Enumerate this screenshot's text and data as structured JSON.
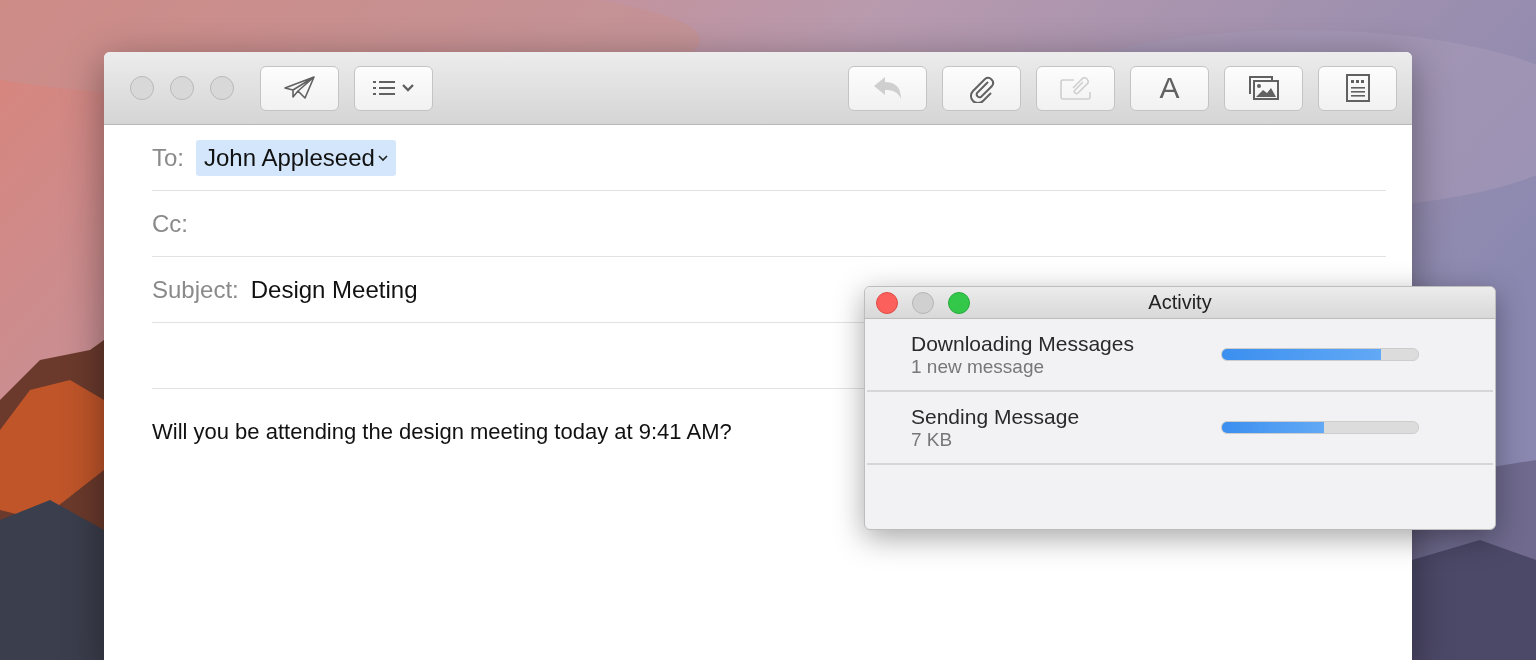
{
  "mail_window": {
    "toolbar": [
      {
        "kind": "send",
        "disabled": false
      },
      {
        "kind": "header-options",
        "disabled": false
      },
      {
        "kind": "reply",
        "disabled": true
      },
      {
        "kind": "attach",
        "disabled": false
      },
      {
        "kind": "markup",
        "disabled": true
      },
      {
        "kind": "fonts",
        "label": "A",
        "disabled": false
      },
      {
        "kind": "photos",
        "disabled": false
      },
      {
        "kind": "stationery",
        "disabled": false
      }
    ],
    "to": {
      "label": "To:",
      "recipient": "John Appleseed"
    },
    "cc": {
      "label": "Cc:"
    },
    "subject": {
      "label": "Subject:",
      "value": "Design Meeting"
    },
    "body": "Will you be attending the design meeting today at 9:41 AM?"
  },
  "activity_window": {
    "title": "Activity",
    "tasks": [
      {
        "name": "Downloading Messages",
        "detail": "1 new message",
        "level": 0.81
      },
      {
        "name": "Sending Message",
        "detail": "7 KB",
        "level": 0.52
      }
    ]
  }
}
